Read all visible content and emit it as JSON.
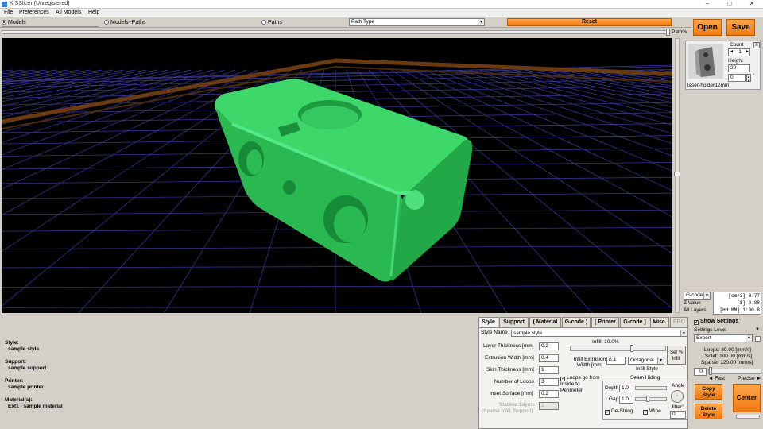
{
  "app": {
    "title": "KISSlicer (Unregistered)"
  },
  "menu": [
    "File",
    "Preferences",
    "All Models",
    "Help"
  ],
  "viewbar": {
    "opt_models": "Models",
    "opt_models_paths": "Models+Paths",
    "opt_paths": "Paths",
    "path_type": "Path Type",
    "reset": "Reset",
    "path_pct": "Path%"
  },
  "actions": {
    "open": "Open",
    "save": "Save"
  },
  "model_panel": {
    "count_label": "Count",
    "close": "X",
    "count_value": "1",
    "height_label": "Height",
    "height_value": "20",
    "angle_value": "0",
    "degree": "°",
    "model_name": "laser-holder12mm"
  },
  "stats": {
    "mode": "G-code",
    "z_label": "Z Value",
    "layers_label": "All Layers",
    "volume": "[cm^3]  8.77",
    "cost": "[$]  0.88",
    "time": "[HH:MM]  1:00.8"
  },
  "summary": {
    "style_label": "Style:",
    "style_value": "sample style",
    "support_label": "Support:",
    "support_value": "sample support",
    "printer_label": "Printer:",
    "printer_value": "sample printer",
    "material_label": "Material(s):",
    "material_value": "Ext1 - sample material"
  },
  "tabs": [
    "Style",
    "Support",
    "( Material",
    "G-code )",
    "[ Printer",
    "G-code ]",
    "Misc.",
    "PRO"
  ],
  "style": {
    "name_label": "Style Name",
    "name_value": "sample style",
    "layer_thickness_label": "Layer Thickness [mm]",
    "layer_thickness": "0.2",
    "extrusion_width_label": "Extrusion Width [mm]",
    "extrusion_width": "0.4",
    "skin_thickness_label": "Skin Thickness [mm]",
    "skin_thickness": "1",
    "loops_label": "Number of Loops",
    "loops": "3",
    "inset_label": "Inset  Surface [mm]",
    "inset": "0.2",
    "stacked_label": "Stacked Layers",
    "stacked_sub": "(Sparse Infill, Support)",
    "stacked": "1",
    "infill_label": "Infill: 10.0%",
    "infill_fraction": 0.1,
    "set_pct_infill": "Set % Infill",
    "infill_extrusion_label": "Infill Extrusion Width [mm]",
    "infill_extrusion": "0.4",
    "infill_style_value": "Octagonal",
    "infill_style_label": "Infill Style",
    "loops_inside_label": "Loops go from Inside to Perimeter",
    "seam_label": "Seam Hiding",
    "depth_label": "Depth",
    "depth": "1.0",
    "gap_label": "Gap",
    "gap": "1.0",
    "angle_label": "Angle",
    "jitter_label": "Jitter°",
    "jitter": "0",
    "destring_label": "De-String",
    "wipe_label": "Wipe"
  },
  "settings": {
    "show_settings": "Show Settings",
    "level_label": "Settings Level",
    "level_value": "Expert",
    "loops_speed": "Loops: 80.00 [mm/s]",
    "solid_speed": "Solid: 100.00 [mm/s]",
    "sparse_speed": "Sparse: 120.00 [mm/s]",
    "speed_value": "0",
    "fast": "Fast",
    "precise": "Precise",
    "copy_style": "Copy Style",
    "delete_style": "Delete Style",
    "center": "Center"
  },
  "colors": {
    "model": "#2fc45a",
    "accent": "#f07a10",
    "grid": "#3a3aa0",
    "bed_border": "#6a3a10"
  }
}
